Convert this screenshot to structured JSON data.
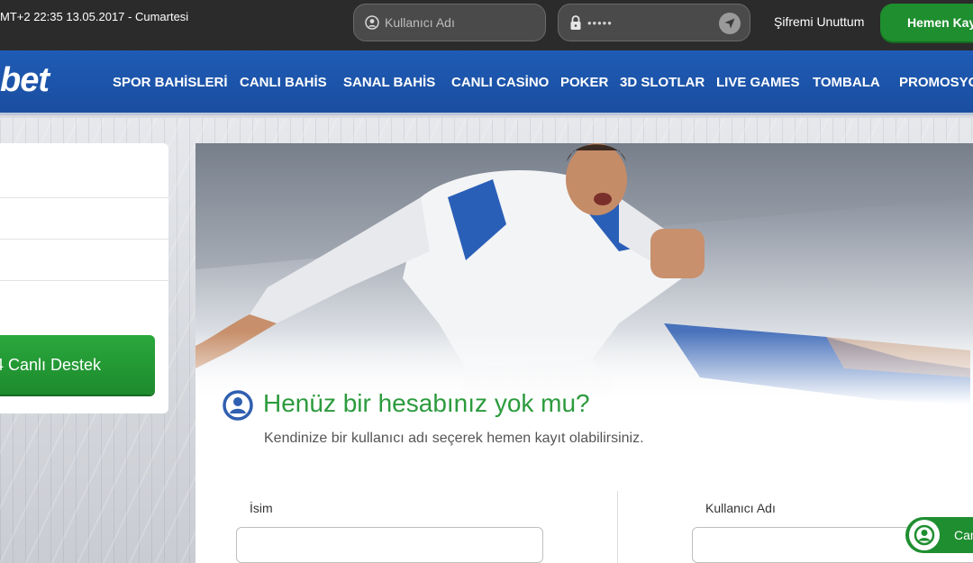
{
  "topbar": {
    "datetime": "MT+2 22:35 13.05.2017 - Cumartesi",
    "username_placeholder": "Kullanıcı Adı",
    "password_value": "•••••",
    "forgot_label": "Şifremi Unuttum",
    "register_label": "Hemen Kayıt"
  },
  "brand": {
    "logo_text": "bet"
  },
  "nav": {
    "items": [
      {
        "label": "SPOR BAHİSLERİ"
      },
      {
        "label": "CANLI BAHİS"
      },
      {
        "label": "SANAL BAHİS"
      },
      {
        "label": "CANLI CASİNO"
      },
      {
        "label": "POKER"
      },
      {
        "label": "3D SLOTLAR"
      },
      {
        "label": "LIVE GAMES"
      },
      {
        "label": "TOMBALA"
      },
      {
        "label": "PROMOSYO"
      }
    ]
  },
  "sidebar": {
    "support_label": "4 Canlı Destek"
  },
  "form": {
    "icon": "user-circle-icon",
    "title": "Henüz bir hesabınız yok mu?",
    "subtitle": "Kendinize bir kullanıcı adı seçerek hemen kayıt olabilirsiniz.",
    "name_label": "İsim",
    "name_value": "",
    "username_label": "Kullanıcı Adı",
    "username_value": ""
  },
  "chat": {
    "label": "Can",
    "icon": "chat-avatar-icon"
  },
  "colors": {
    "topbar": "#2b2b2b",
    "nav": "#1f5bb5",
    "accent_green": "#2c9b3d",
    "button_green": "#1e8e2e"
  }
}
